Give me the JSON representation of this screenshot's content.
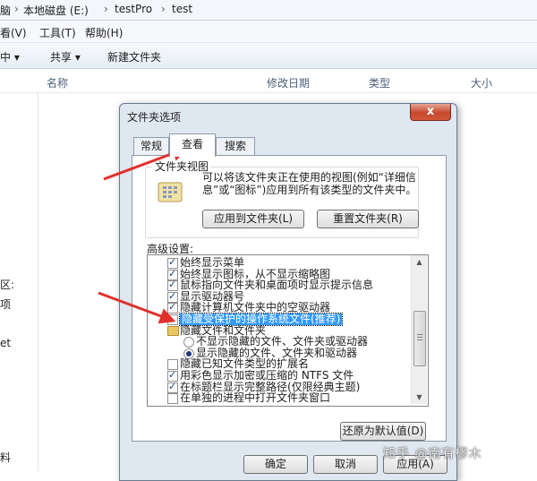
{
  "address": {
    "seg1": "脑",
    "seg2": "本地磁盘 (E:)",
    "seg3": "testPro",
    "seg4": "test"
  },
  "menu": {
    "view": "看(V)",
    "tools": "工具(T)",
    "help": "帮助(H)"
  },
  "toolbar": {
    "include": "中 ▾",
    "share": "共享 ▾",
    "new_folder": "新建文件夹"
  },
  "columns": {
    "name": "名称",
    "modified": "修改日期",
    "type": "类型",
    "size": "大小"
  },
  "nav": {
    "n1": "区:",
    "n2": "项",
    "n3": "et",
    "n4": "料"
  },
  "dialog": {
    "title": "文件夹选项",
    "close": "x",
    "tabs": {
      "general": "常规",
      "view": "查看",
      "search": "搜索"
    },
    "folder_views": {
      "label": "文件夹视图",
      "description": "可以将该文件夹正在使用的视图(例如“详细信息”或“图标”)应用到所有该类型的文件夹中。",
      "apply_button": "应用到文件夹(L)",
      "reset_button": "重置文件夹(R)"
    },
    "advanced_label": "高级设置:",
    "items": [
      {
        "kind": "check",
        "checked": true,
        "label": "始终显示菜单"
      },
      {
        "kind": "check",
        "checked": true,
        "label": "始终显示图标，从不显示缩略图"
      },
      {
        "kind": "check",
        "checked": true,
        "label": "鼠标指向文件夹和桌面项时显示提示信息"
      },
      {
        "kind": "check",
        "checked": true,
        "label": "显示驱动器号"
      },
      {
        "kind": "check",
        "checked": true,
        "label": "隐藏计算机文件夹中的空驱动器"
      },
      {
        "kind": "check",
        "checked": false,
        "selected": true,
        "label": "隐藏受保护的操作系统文件(推荐)"
      },
      {
        "kind": "folder",
        "label": "隐藏文件和文件夹"
      },
      {
        "kind": "radio",
        "checked": false,
        "label": "不显示隐藏的文件、文件夹或驱动器"
      },
      {
        "kind": "radio",
        "checked": true,
        "label": "显示隐藏的文件、文件夹和驱动器"
      },
      {
        "kind": "check",
        "checked": false,
        "label": "隐藏已知文件类型的扩展名"
      },
      {
        "kind": "check",
        "checked": true,
        "label": "用彩色显示加密或压缩的 NTFS 文件"
      },
      {
        "kind": "check",
        "checked": true,
        "label": "在标题栏显示完整路径(仅限经典主题)"
      },
      {
        "kind": "check",
        "checked": false,
        "label": "在单独的进程中打开文件夹窗口"
      }
    ],
    "restore_defaults": "还原为默认值(D)",
    "ok": "确定",
    "cancel": "取消",
    "apply": "应用(A)"
  },
  "watermark": "知乎 @南有樛木",
  "colors": {
    "annotation_arrow": "#e0302c",
    "selection": "#3399ff"
  }
}
